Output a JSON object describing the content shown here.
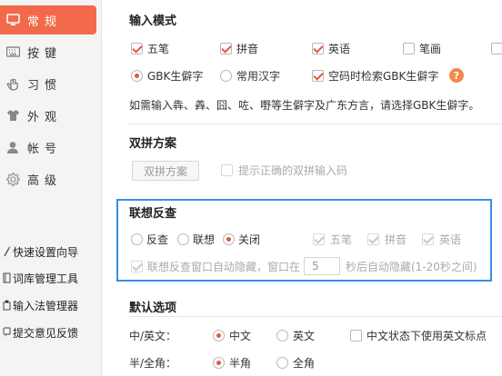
{
  "sidebar": {
    "nav": [
      {
        "label": "常规",
        "icon": "monitor-icon",
        "active": true
      },
      {
        "label": "按键",
        "icon": "keyboard-icon",
        "active": false
      },
      {
        "label": "习惯",
        "icon": "hand-icon",
        "active": false
      },
      {
        "label": "外观",
        "icon": "shirt-icon",
        "active": false
      },
      {
        "label": "帐号",
        "icon": "user-icon",
        "active": false
      },
      {
        "label": "高级",
        "icon": "gear-icon",
        "active": false
      }
    ],
    "tools": [
      {
        "label": "快速设置向导"
      },
      {
        "label": "词库管理工具"
      },
      {
        "label": "输入法管理器"
      },
      {
        "label": "提交意见反馈"
      }
    ]
  },
  "input_mode": {
    "title": "输入模式",
    "modes": [
      {
        "label": "五笔",
        "checked": true
      },
      {
        "label": "拼音",
        "checked": true
      },
      {
        "label": "英语",
        "checked": true
      },
      {
        "label": "笔画",
        "checked": false
      }
    ],
    "charset": {
      "gbk_label": "GBK生僻字",
      "common_label": "常用汉字",
      "space_search_label": "空码时检索GBK生僻字"
    },
    "hint": "如需输入犇、羴、囧、咗、嘢等生僻字及广东方言，请选择GBK生僻字。"
  },
  "shuangpin": {
    "title": "双拼方案",
    "button_label": "双拼方案",
    "hint_checkbox_label": "提示正确的双拼输入码"
  },
  "reverse_lookup": {
    "title": "联想反查",
    "options": [
      "反查",
      "联想",
      "关闭"
    ],
    "selected": "关闭",
    "sub_modes": [
      "五笔",
      "拼音",
      "英语"
    ],
    "auto_hide_label": "联想反查窗口自动隐藏，窗口在",
    "auto_hide_value": "5",
    "auto_hide_suffix": "秒后自动隐藏(1-20秒之间)"
  },
  "defaults": {
    "title": "默认选项",
    "lang_label": "中/英文：",
    "lang_options": [
      "中文",
      "英文"
    ],
    "lang_selected": "中文",
    "use_en_punct_label": "中文状态下使用英文标点",
    "width_label": "半/全角：",
    "width_options": [
      "半角",
      "全角"
    ],
    "width_selected": "半角"
  },
  "colors": {
    "accent": "#f26a4a",
    "check": "#e25a3c",
    "highlight_border": "#3a8ee6"
  }
}
